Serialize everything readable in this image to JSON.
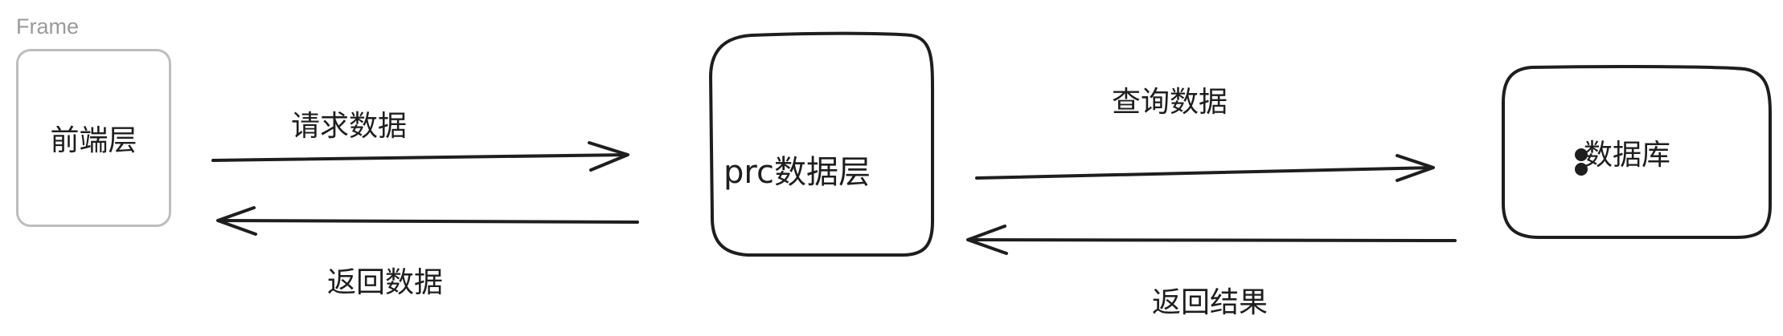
{
  "frame": {
    "label": "Frame"
  },
  "nodes": {
    "frontend": "前端层",
    "rpc": "prc数据层",
    "database": "数据库"
  },
  "edges": {
    "request": "请求数据",
    "return_data": "返回数据",
    "query": "查询数据",
    "return_result": "返回结果"
  },
  "colors": {
    "stroke": "#1e1e1e",
    "frame_border": "#bdbdbd",
    "frame_label": "#9a9a9a",
    "background": "#ffffff"
  }
}
